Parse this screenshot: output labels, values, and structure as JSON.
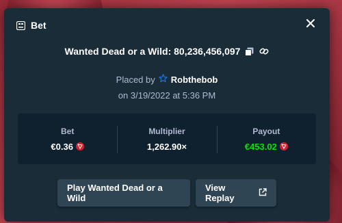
{
  "header": {
    "title": "Bet",
    "icon": "bet-slip-icon",
    "close_icon": "close-icon"
  },
  "game": {
    "title": "Wanted Dead or a Wild: 80,236,456,097",
    "copy_icon": "copy-icon",
    "link_icon": "link-icon"
  },
  "placed": {
    "prefix": "Placed by",
    "user_icon": "star-badge-icon",
    "username": "Robthebob",
    "date": "on 3/19/2022 at 5:36 PM"
  },
  "stats": {
    "bet_label": "Bet",
    "bet_value": "€0.36",
    "multiplier_label": "Multiplier",
    "multiplier_value": "1,262.90×",
    "payout_label": "Payout",
    "payout_value": "€453.02",
    "currency_icon": "tron-coin-icon"
  },
  "buttons": {
    "play_label": "Play Wanted Dead or a Wild",
    "replay_label": "View Replay",
    "replay_icon": "external-link-icon"
  },
  "colors": {
    "modal_bg": "#1a2c38",
    "stats_bg": "#0f212e",
    "button_bg": "#2f4553",
    "muted_text": "#b1bad3",
    "payout_green": "#00e701",
    "coin_red": "#d61f2c",
    "star_blue": "#1475e1"
  }
}
